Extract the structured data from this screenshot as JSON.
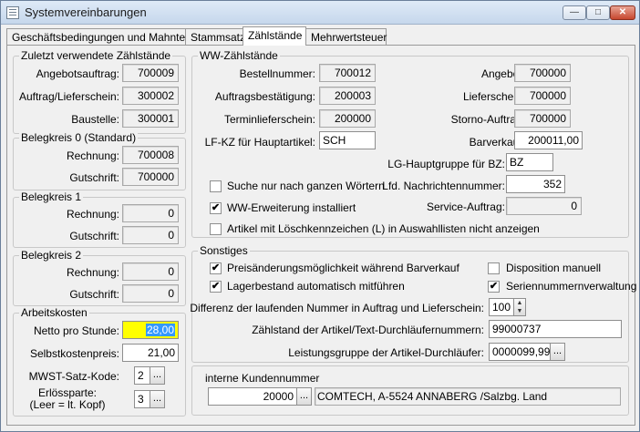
{
  "window": {
    "title": "Systemvereinbarungen",
    "min_glyph": "—",
    "max_glyph": "□",
    "close_glyph": "✕"
  },
  "tabs": [
    "Geschäftsbedingungen und Mahntext",
    "Stammsatz",
    "Zählstände",
    "Mehrwertsteuer"
  ],
  "active_tab": "Zählstände",
  "left": {
    "zuletzt": {
      "title": "Zuletzt verwendete Zählstände",
      "angebotsauftrag": {
        "label": "Angebotsauftrag:",
        "value": "700009"
      },
      "auftrag_lieferschein": {
        "label": "Auftrag/Lieferschein:",
        "value": "300002"
      },
      "baustelle": {
        "label": "Baustelle:",
        "value": "300001"
      }
    },
    "belegkreis0": {
      "title": "Belegkreis 0 (Standard)",
      "rechnung_label": "Rechnung:",
      "rechnung": "700008",
      "gutschrift_label": "Gutschrift:",
      "gutschrift": "700000"
    },
    "belegkreis1": {
      "title": "Belegkreis 1",
      "rechnung_label": "Rechnung:",
      "rechnung": "0",
      "gutschrift_label": "Gutschrift:",
      "gutschrift": "0"
    },
    "belegkreis2": {
      "title": "Belegkreis 2",
      "rechnung_label": "Rechnung:",
      "rechnung": "0",
      "gutschrift_label": "Gutschrift:",
      "gutschrift": "0"
    },
    "arbeitskosten": {
      "title": "Arbeitskosten",
      "netto_label": "Netto pro Stunde:",
      "netto": "28,00",
      "selbstkosten_label": "Selbstkostenpreis:",
      "selbstkosten": "21,00",
      "mwst_label": "MWST-Satz-Kode:",
      "mwst": "2",
      "erloes_label1": "Erlössparte:",
      "erloes_label2": "(Leer = lt. Kopf)",
      "erloes": "3"
    }
  },
  "ww": {
    "title": "WW-Zählstände",
    "bestellnummer": {
      "label": "Bestellnummer:",
      "value": "700012"
    },
    "auftragsbestaetigung": {
      "label": "Auftragsbestätigung:",
      "value": "200003"
    },
    "terminlieferschein": {
      "label": "Terminlieferschein:",
      "value": "200000"
    },
    "lf_kz": {
      "label": "LF-KZ für Hauptartikel:",
      "value": "SCH"
    },
    "angebot": {
      "label": "Angebot:",
      "value": "700000"
    },
    "lieferschein": {
      "label": "Lieferschein:",
      "value": "700000"
    },
    "storno": {
      "label": "Storno-Auftrag:",
      "value": "700000"
    },
    "barverkauf": {
      "label": "Barverkauf:",
      "value": "200011,00"
    },
    "lg_hauptgruppe": {
      "label": "LG-Hauptgruppe für BZ:",
      "value": "BZ"
    },
    "lfd_nachrichten": {
      "label": "Lfd. Nachrichtennummer:",
      "value": "352"
    },
    "service_auftrag": {
      "label": "Service-Auftrag:",
      "value": "0"
    },
    "suche_ganzen": {
      "label": "Suche nur nach ganzen Wörtern",
      "checked": false
    },
    "ww_erweiterung": {
      "label": "WW-Erweiterung installiert",
      "checked": true
    },
    "loeschkennzeichen": {
      "label": "Artikel mit Löschkennzeichen (L) in Auswahllisten nicht anzeigen",
      "checked": false
    }
  },
  "sonstiges": {
    "title": "Sonstiges",
    "preisaenderung": {
      "label": "Preisänderungsmöglichkeit während Barverkauf",
      "checked": true
    },
    "lagerbestand": {
      "label": "Lagerbestand automatisch mitführen",
      "checked": true
    },
    "disposition": {
      "label": "Disposition manuell",
      "checked": false
    },
    "seriennummern": {
      "label": "Seriennummernverwaltung",
      "checked": true
    },
    "check_glyph": "✔",
    "differenz": {
      "label": "Differenz der laufenden Nummer in Auftrag und Lieferschein:",
      "value": "100"
    },
    "zaehlstand_durchlaeufer": {
      "label": "Zählstand der Artikel/Text-Durchläufernummern:",
      "value": "99000737"
    },
    "leistungsgruppe": {
      "label": "Leistungsgruppe der Artikel-Durchläufer:",
      "value": "0000099,99"
    }
  },
  "kunde": {
    "label": "interne Kundennummer",
    "value": "20000",
    "name": "COMTECH, A-5524 ANNABERG /Salzbg. Land"
  },
  "lookup_glyph": "...",
  "spin_up": "▲",
  "spin_down": "▼"
}
